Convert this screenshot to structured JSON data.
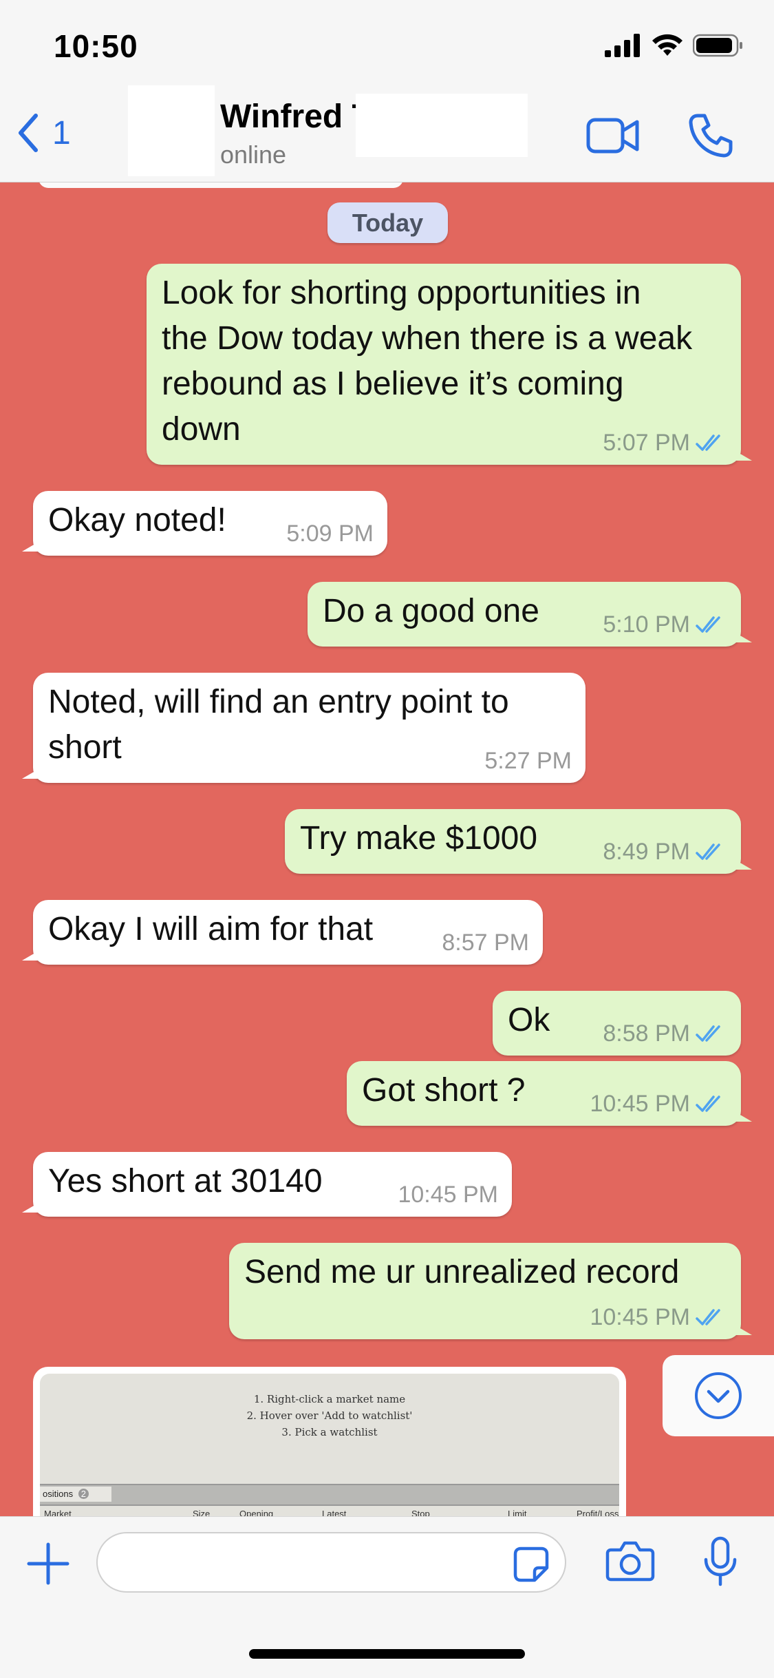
{
  "status_bar": {
    "time": "10:50"
  },
  "header": {
    "back_count": "1",
    "contact_name": "Winfred T",
    "presence": "online"
  },
  "date_separator": "Today",
  "messages": [
    {
      "dir": "out",
      "text": "Look for shorting opportunities in\nthe Dow today when there is a weak\nrebound as I believe it’s coming\ndown",
      "time": "5:07 PM"
    },
    {
      "dir": "in",
      "text": "Okay noted!",
      "time": "5:09 PM"
    },
    {
      "dir": "out",
      "text": "Do a good one",
      "time": "5:10 PM"
    },
    {
      "dir": "in",
      "text": "Noted, will find an entry point to\nshort",
      "time": "5:27 PM"
    },
    {
      "dir": "out",
      "text": "Try make $1000",
      "time": "8:49 PM"
    },
    {
      "dir": "in",
      "text": "Okay I will aim for that",
      "time": "8:57 PM"
    },
    {
      "dir": "out",
      "text": "Ok",
      "time": "8:58 PM"
    },
    {
      "dir": "out",
      "text": "Got short ?",
      "time": "10:45 PM"
    },
    {
      "dir": "in",
      "text": "Yes short at 30140",
      "time": "10:45 PM"
    },
    {
      "dir": "out",
      "text": "Send me ur unrealized record",
      "time": "10:45 PM"
    }
  ],
  "image_message": {
    "lines": [
      "1. Right-click a market name",
      "2. Hover over 'Add to watchlist'",
      "3. Pick a watchlist"
    ],
    "tab_label": "ositions",
    "tab_count": "2",
    "columns": [
      "Market",
      "Size",
      "Opening",
      "Latest",
      "Stop",
      "Limit",
      "Profit/Loss"
    ]
  },
  "colors": {
    "chat_bg": "#e2675e",
    "outgoing": "#e1f6cb",
    "incoming": "#ffffff",
    "accent": "#2a6de0",
    "read_ticks": "#4fa3f0"
  }
}
